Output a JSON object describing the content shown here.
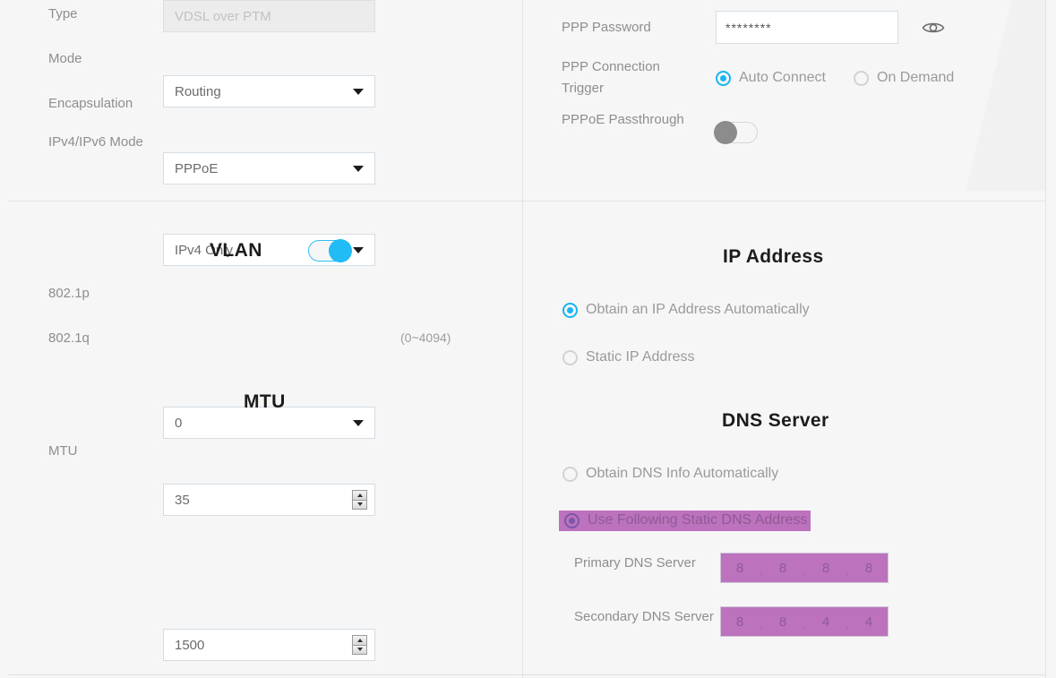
{
  "left_panel": {
    "wan_fields": [
      {
        "label": "Type",
        "value": "VDSL over PTM",
        "control": "text-disabled"
      },
      {
        "label": "Mode",
        "value": "Routing",
        "control": "select"
      },
      {
        "label": "Encapsulation",
        "value": "PPPoE",
        "control": "select"
      },
      {
        "label": "IPv4/IPv6 Mode",
        "value": "IPv4 Only",
        "control": "select"
      }
    ],
    "vlan": {
      "title": "VLAN",
      "toggle_state": "on",
      "p_label": "802.1p",
      "p_value": "0",
      "q_label": "802.1q",
      "q_value": "35",
      "q_hint": "(0~4094)"
    },
    "mtu": {
      "title": "MTU",
      "label": "MTU",
      "value": "1500"
    }
  },
  "right_panel": {
    "ppp": {
      "password_label": "PPP Password",
      "password_value": "********",
      "eye_icon": "eye-icon",
      "trigger_label": "PPP Connection Trigger",
      "trigger_options": [
        {
          "label": "Auto Connect",
          "selected": true
        },
        {
          "label": "On Demand",
          "selected": false
        }
      ],
      "passthrough_label": "PPPoE Passthrough",
      "passthrough_state": "off"
    },
    "ip_address": {
      "title": "IP Address",
      "options": [
        {
          "label": "Obtain an IP Address Automatically",
          "selected": true
        },
        {
          "label": "Static IP Address",
          "selected": false
        }
      ]
    },
    "dns_server": {
      "title": "DNS Server",
      "options": [
        {
          "label": "Obtain DNS Info Automatically",
          "selected": false
        },
        {
          "label": "Use Following Static DNS Address",
          "selected": true
        }
      ],
      "primary_label": "Primary DNS Server",
      "primary_octets": [
        "8",
        "8",
        "8",
        "8"
      ],
      "secondary_label": "Secondary DNS Server",
      "secondary_octets": [
        "8",
        "8",
        "4",
        "4"
      ],
      "separator": "."
    }
  },
  "colors": {
    "accent": "#17b5f1",
    "toggle_on": "#21bcf5",
    "toggle_off": "#8c8c8c",
    "selection_highlight": "#bd72be",
    "page_background": "#f6f6f6",
    "heading": "#1c1c1c",
    "label": "#8e8e8e"
  }
}
